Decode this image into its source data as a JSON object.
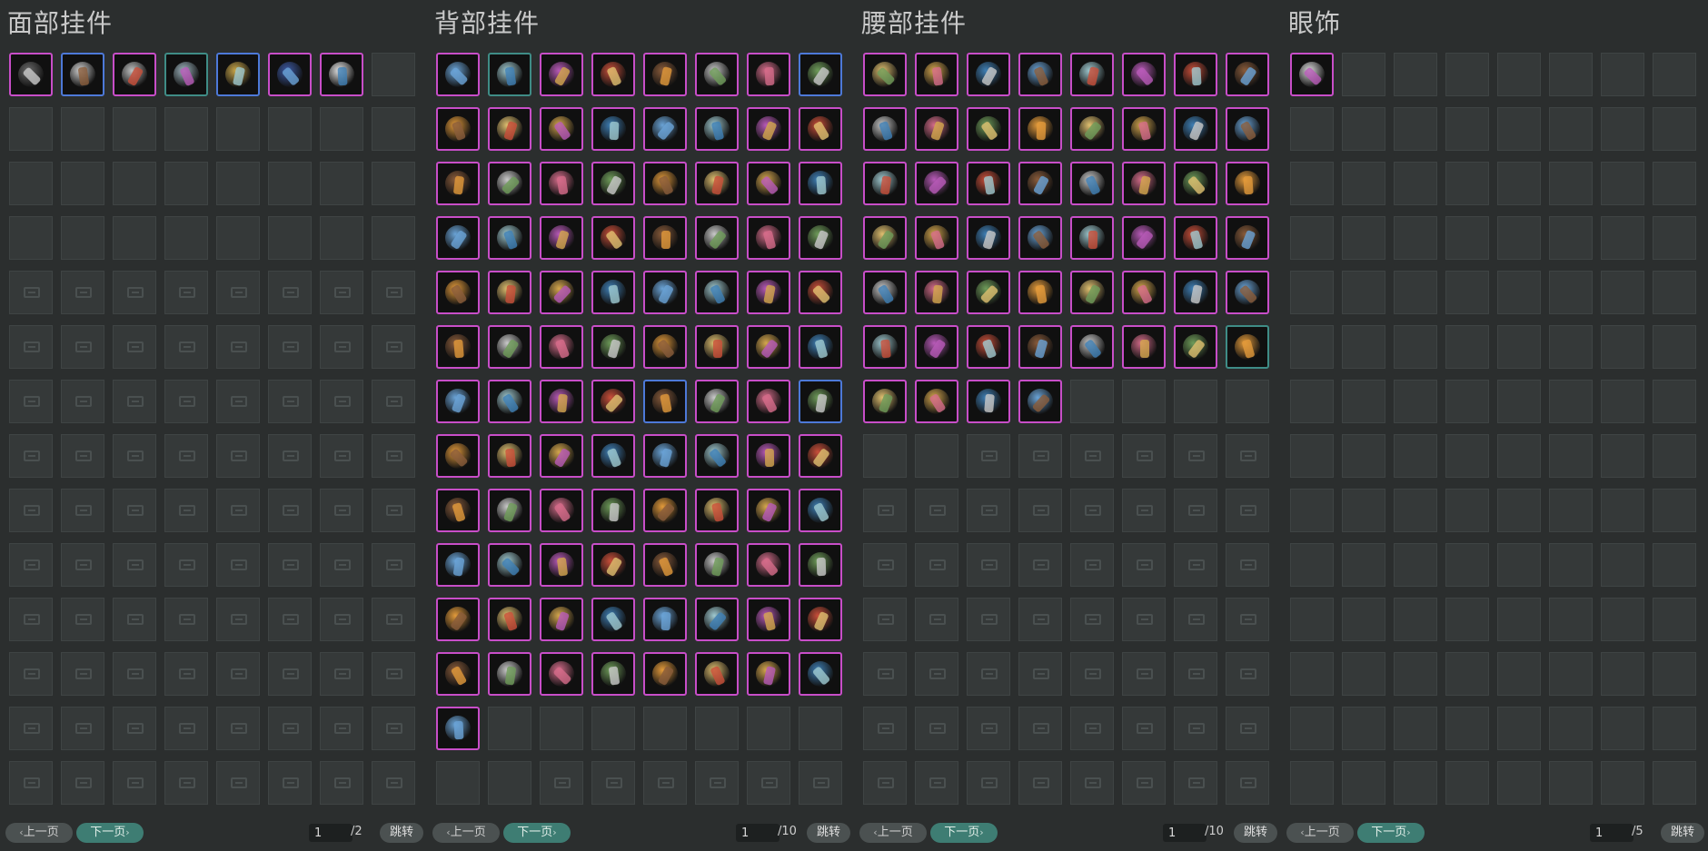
{
  "panels": [
    {
      "title": "面部挂件",
      "items": 7,
      "blank_until": 32,
      "current_page": "1",
      "total": "/2",
      "colors": [
        "#6a6a6a",
        "#d0d0d0",
        "#bfc0c0",
        "#9fb6c0",
        "#c9a64a",
        "#3d5aa5",
        "#e6e6e6"
      ]
    },
    {
      "title": "背部挂件",
      "items": 97,
      "blank_until": 106,
      "current_page": "1",
      "total": "/10",
      "colors": []
    },
    {
      "title": "腰部挂件",
      "items": 52,
      "blank_until": 58,
      "current_page": "1",
      "total": "/10",
      "colors": []
    },
    {
      "title": "眼饰",
      "items": 1,
      "blank_until": 112,
      "current_page": "1",
      "total": "/5",
      "colors": [
        "#dcdcdc"
      ]
    }
  ],
  "nav": {
    "prev_label": "上一页",
    "next_label": "下一页",
    "jump_label": "跳转"
  },
  "palette": [
    "#c94f3a",
    "#d5a74e",
    "#c9c9c9",
    "#6aa3d6",
    "#6f9c5a",
    "#b85ab8",
    "#e0c070",
    "#8a5c3b",
    "#3f7fb5",
    "#d46c8a",
    "#9fc9d0",
    "#e29a3b"
  ],
  "accents": {
    "item_border": "#c84ec8",
    "item_border_alt": "#4d79d8",
    "item_border_teal": "#3f8c86",
    "next_button": "#3e7d73"
  }
}
